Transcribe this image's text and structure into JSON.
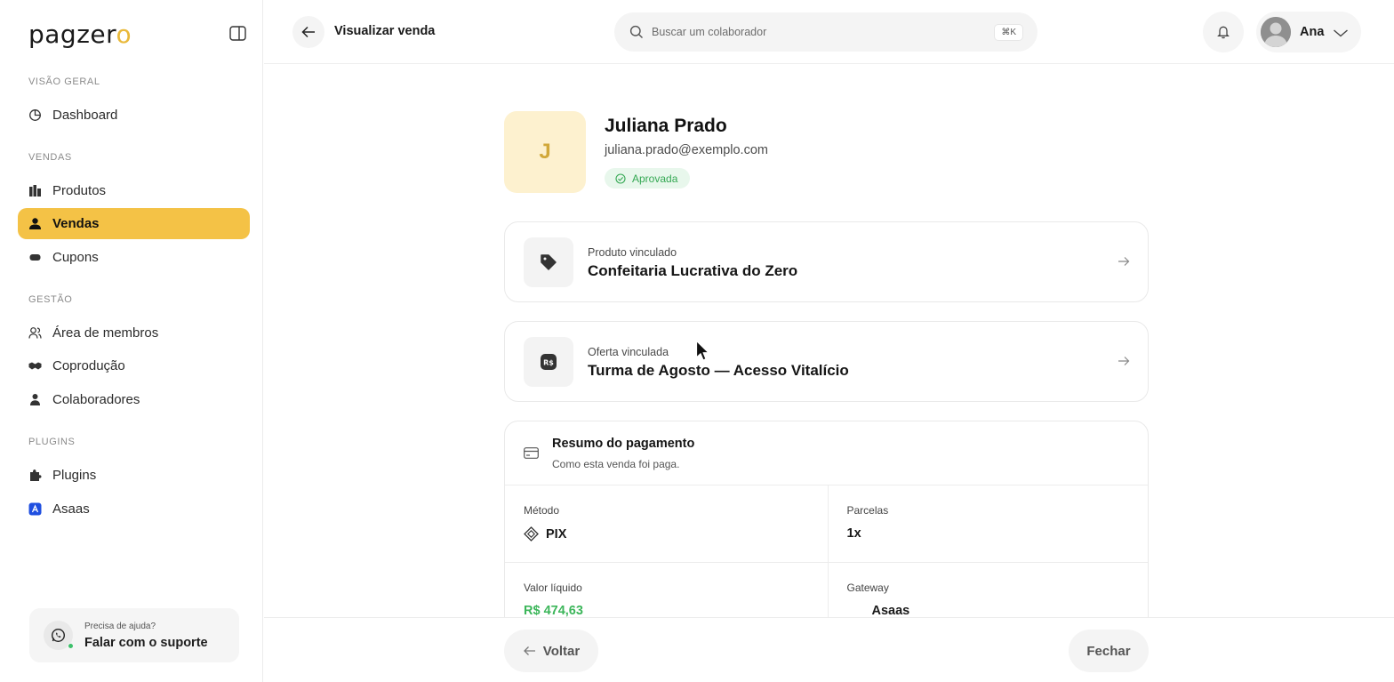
{
  "sidebar": {
    "logo_text": "pagzer",
    "logo_o": "o",
    "sections": {
      "overview": "VISÃO GERAL",
      "sales": "VENDAS",
      "management": "GESTÃO",
      "plugins": "PLUGINS"
    },
    "items": {
      "dashboard": "Dashboard",
      "products": "Produtos",
      "sales": "Vendas",
      "coupons": "Cupons",
      "members": "Área de membros",
      "coproduction": "Coprodução",
      "collaborators": "Colaboradores",
      "plugins": "Plugins",
      "asaas": "Asaas"
    },
    "help": {
      "question": "Precisa de ajuda?",
      "action": "Falar com o suporte"
    }
  },
  "header": {
    "title": "Visualizar venda",
    "search_placeholder": "Buscar um colaborador",
    "shortcut": "⌘K",
    "user_name": "Ana"
  },
  "customer": {
    "initial": "J",
    "name": "Juliana Prado",
    "email": "juliana.prado@exemplo.com",
    "status": "Aprovada"
  },
  "product_card": {
    "label": "Produto vinculado",
    "value": "Confeitaria Lucrativa do Zero"
  },
  "offer_card": {
    "label": "Oferta vinculada",
    "value": "Turma de Agosto — Acesso Vitalício"
  },
  "payment": {
    "title": "Resumo do pagamento",
    "subtitle": "Como esta venda foi paga.",
    "method_label": "Método",
    "method_value": "PIX",
    "installments_label": "Parcelas",
    "installments_value": "1x",
    "net_label": "Valor líquido",
    "net_value": "R$ 474,63",
    "gateway_label": "Gateway",
    "gateway_value": "Asaas"
  },
  "footer": {
    "back_label": "Voltar",
    "close_label": "Fechar"
  },
  "colors": {
    "accent": "#f4c246",
    "success": "#3cb65a",
    "asaas_blue": "#1f4fe0"
  }
}
